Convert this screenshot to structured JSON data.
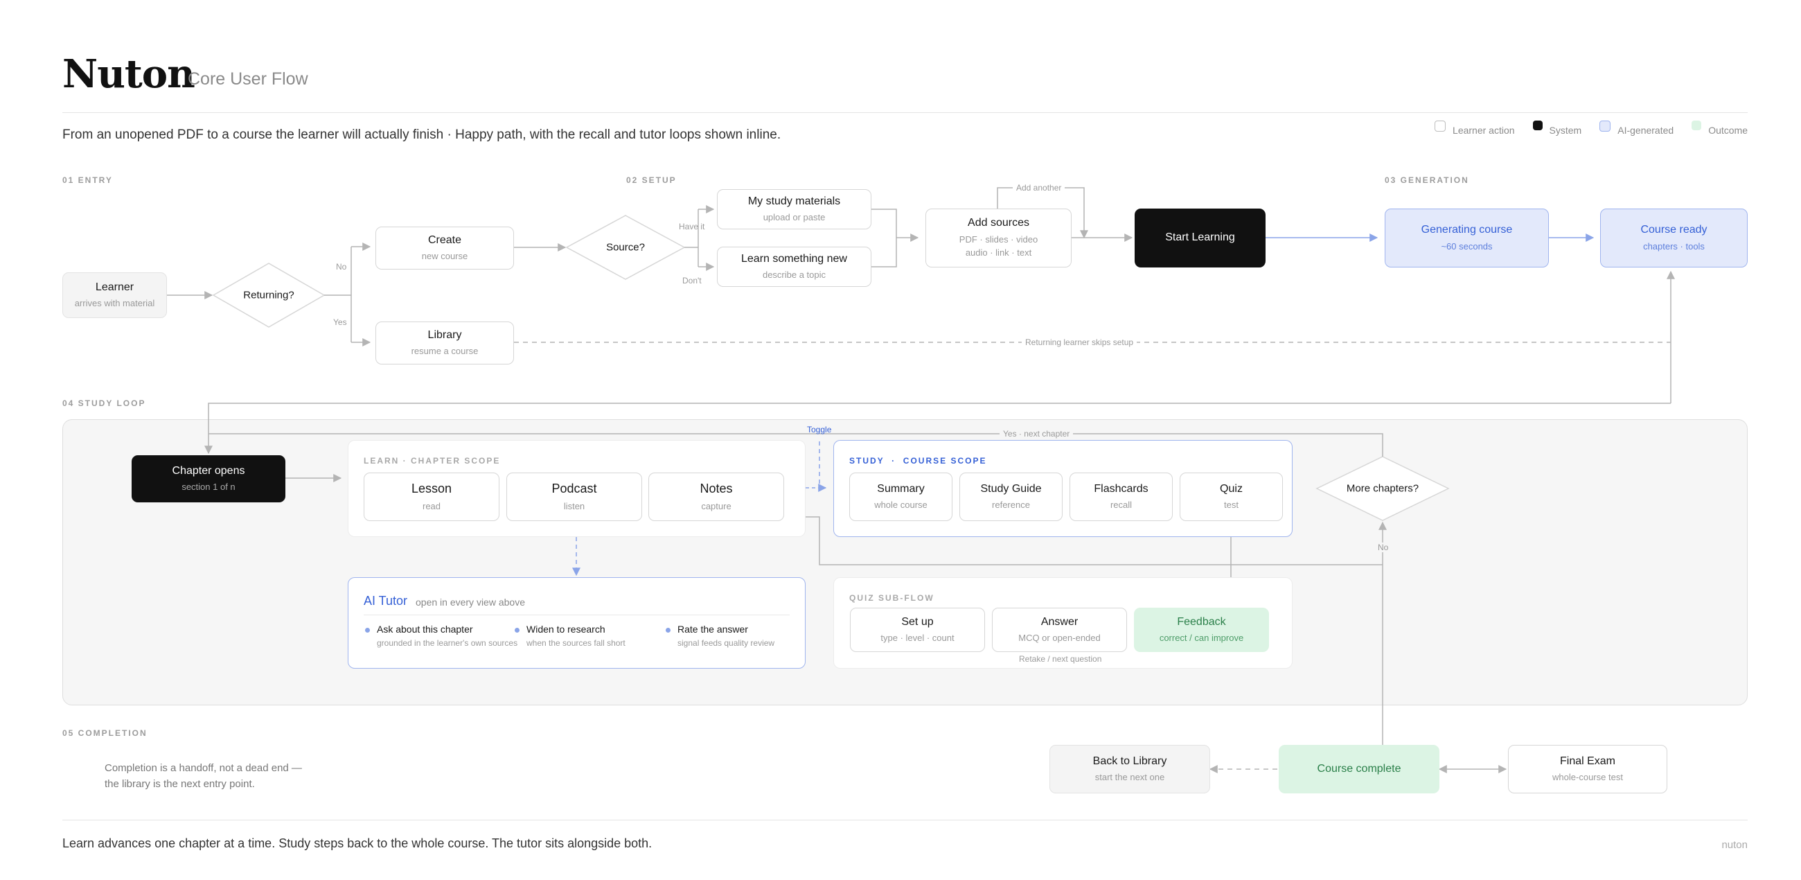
{
  "header": {
    "title": "Nuton",
    "subtitle": "Core User Flow",
    "tagline": "From an unopened PDF to a course the learner will actually finish  ·  Happy path, with the recall and tutor loops shown inline."
  },
  "legend": [
    {
      "label": "Learner action",
      "kind": "learner"
    },
    {
      "label": "System",
      "kind": "system"
    },
    {
      "label": "AI-generated",
      "kind": "ai"
    },
    {
      "label": "Outcome",
      "kind": "outcome"
    }
  ],
  "sections": {
    "entry": "01  ENTRY",
    "setup": "02  SETUP",
    "generation": "03  GENERATION",
    "study_loop": "04  STUDY LOOP",
    "completion": "05  COMPLETION"
  },
  "entry": {
    "learner": {
      "title": "Learner",
      "sub": "arrives with material"
    },
    "returning": "Returning?",
    "no_label": "No",
    "yes_label": "Yes",
    "create": {
      "title": "Create",
      "sub": "new course"
    },
    "library": {
      "title": "Library",
      "sub": "resume a course"
    }
  },
  "setup": {
    "source": "Source?",
    "have_it": "Have it",
    "dont": "Don't",
    "materials": {
      "title": "My study materials",
      "sub": "upload or paste"
    },
    "learn_new": {
      "title": "Learn something new",
      "sub": "describe a topic"
    },
    "add_sources": {
      "title": "Add sources",
      "sub1": "PDF · slides · video",
      "sub2": "audio · link · text"
    },
    "add_another": "Add another",
    "start": "Start Learning",
    "skip_setup": "Returning learner skips setup"
  },
  "generation": {
    "generating": {
      "title": "Generating course",
      "sub": "~60 seconds"
    },
    "ready": {
      "title": "Course ready",
      "sub": "chapters · tools"
    }
  },
  "study_loop": {
    "chapter": {
      "title": "Chapter opens",
      "sub": "section 1 of n"
    },
    "learn_head": "LEARN  ·  CHAPTER SCOPE",
    "lesson": {
      "title": "Lesson",
      "sub": "read"
    },
    "podcast": {
      "title": "Podcast",
      "sub": "listen"
    },
    "notes": {
      "title": "Notes",
      "sub": "capture"
    },
    "toggle": "Toggle",
    "yes_next": "Yes  ·  next chapter",
    "study_head_a": "STUDY",
    "study_head_sep": "  ·  ",
    "study_head_b": "COURSE SCOPE",
    "summary": {
      "title": "Summary",
      "sub": "whole course"
    },
    "study_guide": {
      "title": "Study Guide",
      "sub": "reference"
    },
    "flashcards": {
      "title": "Flashcards",
      "sub": "recall"
    },
    "quiz": {
      "title": "Quiz",
      "sub": "test"
    },
    "more_chapters": "More chapters?",
    "no_label": "No",
    "tutor": {
      "title": "AI Tutor",
      "sub": "open in every view above",
      "items": [
        {
          "title": "Ask about this chapter",
          "sub": "grounded in the learner's own sources"
        },
        {
          "title": "Widen to research",
          "sub": "when the sources fall short"
        },
        {
          "title": "Rate the answer",
          "sub": "signal feeds quality review"
        }
      ]
    },
    "quiz_head": "QUIZ SUB-FLOW",
    "setup_node": {
      "title": "Set up",
      "sub": "type · level · count"
    },
    "answer": {
      "title": "Answer",
      "sub": "MCQ or open-ended"
    },
    "feedback": {
      "title": "Feedback",
      "sub": "correct / can improve"
    },
    "retake": "Retake / next question"
  },
  "completion": {
    "note_line1": "Completion is a handoff, not a dead end —",
    "note_line2": "the library is the next entry point.",
    "back": {
      "title": "Back to Library",
      "sub": "start the next one"
    },
    "complete": "Course complete",
    "exam": {
      "title": "Final Exam",
      "sub": "whole-course test"
    }
  },
  "footer": {
    "text": "Learn advances one chapter at a time. Study steps back to the whole course. The tutor sits alongside both.",
    "brand": "nuton"
  },
  "colors": {
    "accent_blue": "#3560d6",
    "ai_fill": "#e3e9fb",
    "outcome_fill": "#dcf4e4",
    "system_fill": "#111111",
    "connector": "#b4b4b4"
  }
}
